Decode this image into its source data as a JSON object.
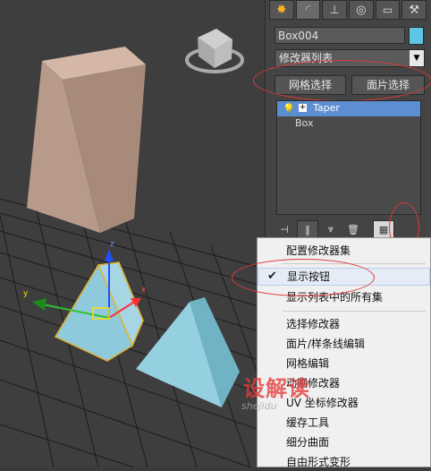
{
  "command_panel": {
    "tabs": [
      "create-icon",
      "modify-icon",
      "hierarchy-icon",
      "motion-icon",
      "display-icon",
      "utilities-icon"
    ],
    "object_name": "Box004",
    "object_color": "#5ec6e5",
    "modifier_list": "修改器列表",
    "buttons": [
      "网格选择",
      "面片选择"
    ],
    "stack": [
      {
        "label": "Taper",
        "selected": true
      },
      {
        "label": "Box",
        "selected": false
      }
    ]
  },
  "context_menu": {
    "items": [
      {
        "label": "配置修改器集",
        "checked": false
      },
      {
        "label": "显示按钮",
        "checked": true
      },
      {
        "label": "显示列表中的所有集",
        "checked": false
      },
      {
        "label": "选择修改器",
        "checked": false
      },
      {
        "label": "面片/样条线编辑",
        "checked": false
      },
      {
        "label": "网格编辑",
        "checked": false
      },
      {
        "label": "动画修改器",
        "checked": false
      },
      {
        "label": "UV 坐标修改器",
        "checked": false
      },
      {
        "label": "缓存工具",
        "checked": false
      },
      {
        "label": "细分曲面",
        "checked": false
      },
      {
        "label": "自由形式变形",
        "checked": false
      }
    ]
  },
  "gizmo_axes": {
    "x": "x",
    "y": "y",
    "z": "z"
  },
  "watermark": {
    "text": "设解读",
    "url": "shejidu"
  }
}
